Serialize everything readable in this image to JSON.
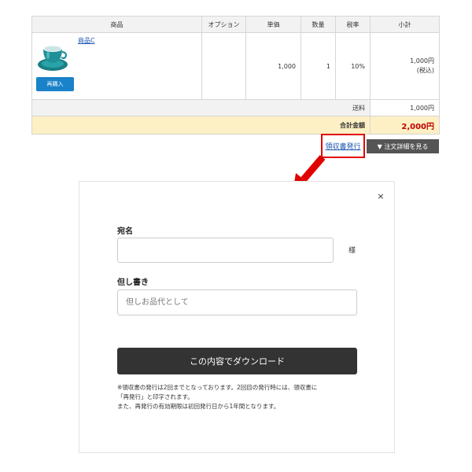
{
  "table": {
    "headers": {
      "product": "商品",
      "option": "オプション",
      "unit_price": "単価",
      "quantity": "数量",
      "tax_rate": "税率",
      "subtotal": "小計"
    },
    "row": {
      "product_name": "商品C",
      "rebuy_label": "再購入",
      "option": "",
      "unit_price": "1,000",
      "quantity": "1",
      "tax_rate": "10%",
      "subtotal": "1,000円",
      "subtotal_note": "(税込)"
    },
    "shipping": {
      "label": "送料",
      "value": "1,000円"
    },
    "total": {
      "label": "合計金額",
      "value": "2,000円"
    }
  },
  "actions": {
    "receipt_link": "領収書発行",
    "order_detail": "▼ 注文詳細を見る"
  },
  "modal": {
    "close": "×",
    "addressee_label": "宛名",
    "addressee_value": "",
    "honorific": "様",
    "memo_label": "但し書き",
    "memo_placeholder": "但しお品代として",
    "download_label": "この内容でダウンロード",
    "notes": [
      "※領収書の発行は2回までとなっております。2回目の発行時には、領収書に",
      "「再発行」と印字されます。",
      "また、再発行の有効期限は初回発行日から1年間となります。"
    ]
  },
  "colors": {
    "highlight_border": "#e00000",
    "arrow": "#e00000",
    "total_bg": "#fdf0c4",
    "total_text": "#c00000",
    "rebuy_button": "#1a82c8",
    "download_button": "#333333"
  }
}
